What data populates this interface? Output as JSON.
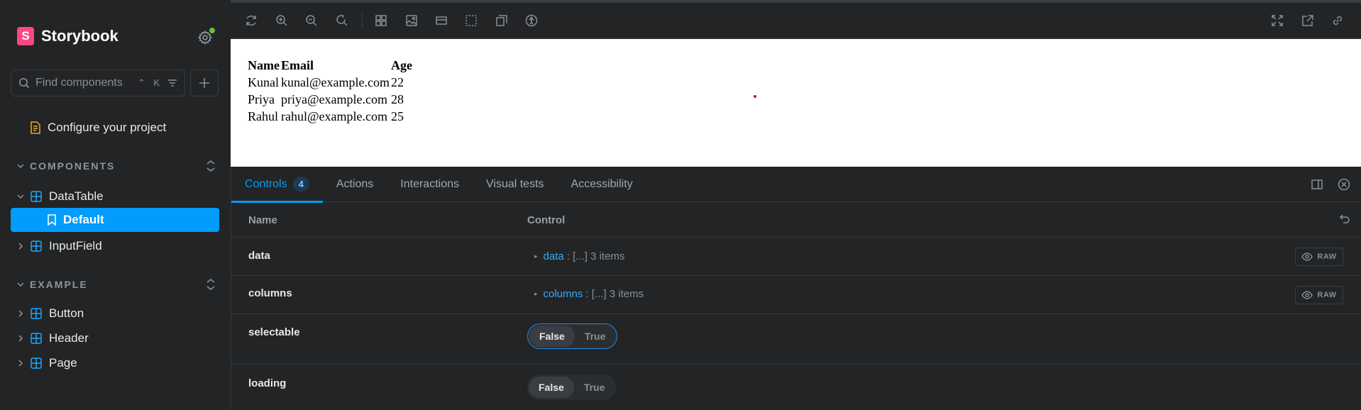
{
  "app": {
    "brand": "Storybook",
    "accent": "#029cfd",
    "brand_color": "#ff4785"
  },
  "sidebar": {
    "search": {
      "placeholder": "Find components",
      "shortcut": "⌃ K"
    },
    "configure_label": "Configure your project",
    "sections": [
      {
        "label": "COMPONENTS",
        "items": [
          {
            "label": "DataTable",
            "expanded": true,
            "stories": [
              {
                "label": "Default",
                "selected": true
              }
            ]
          },
          {
            "label": "InputField",
            "expanded": false
          }
        ]
      },
      {
        "label": "EXAMPLE",
        "items": [
          {
            "label": "Button",
            "expanded": false
          },
          {
            "label": "Header",
            "expanded": false
          },
          {
            "label": "Page",
            "expanded": false
          }
        ]
      }
    ]
  },
  "toolbar": {
    "left_icons": [
      "reload-icon",
      "zoom-in-icon",
      "zoom-out-icon",
      "zoom-reset-icon",
      "grid-icon",
      "background-icon",
      "viewport-icon",
      "outline-icon",
      "measure-icon",
      "accessibility-icon"
    ],
    "right_icons": [
      "fullscreen-icon",
      "open-new-tab-icon",
      "copy-link-icon"
    ]
  },
  "preview": {
    "headers": [
      "Name",
      "Email",
      "Age"
    ],
    "rows": [
      [
        "Kunal",
        "kunal@example.com",
        "22"
      ],
      [
        "Priya",
        "priya@example.com",
        "28"
      ],
      [
        "Rahul",
        "rahul@example.com",
        "25"
      ]
    ]
  },
  "panel": {
    "tabs": [
      {
        "label": "Controls",
        "badge": "4",
        "active": true
      },
      {
        "label": "Actions"
      },
      {
        "label": "Interactions"
      },
      {
        "label": "Visual tests"
      },
      {
        "label": "Accessibility"
      }
    ],
    "columns": {
      "name": "Name",
      "control": "Control"
    },
    "rows": [
      {
        "name": "data",
        "key": "data",
        "summary": ": [...] 3 items",
        "raw": "RAW"
      },
      {
        "name": "columns",
        "key": "columns",
        "summary": ": [...] 3 items",
        "raw": "RAW"
      },
      {
        "name": "selectable",
        "options": [
          "False",
          "True"
        ],
        "selected": "False"
      },
      {
        "name": "loading",
        "options": [
          "False",
          "True"
        ],
        "selected": "False"
      }
    ]
  }
}
